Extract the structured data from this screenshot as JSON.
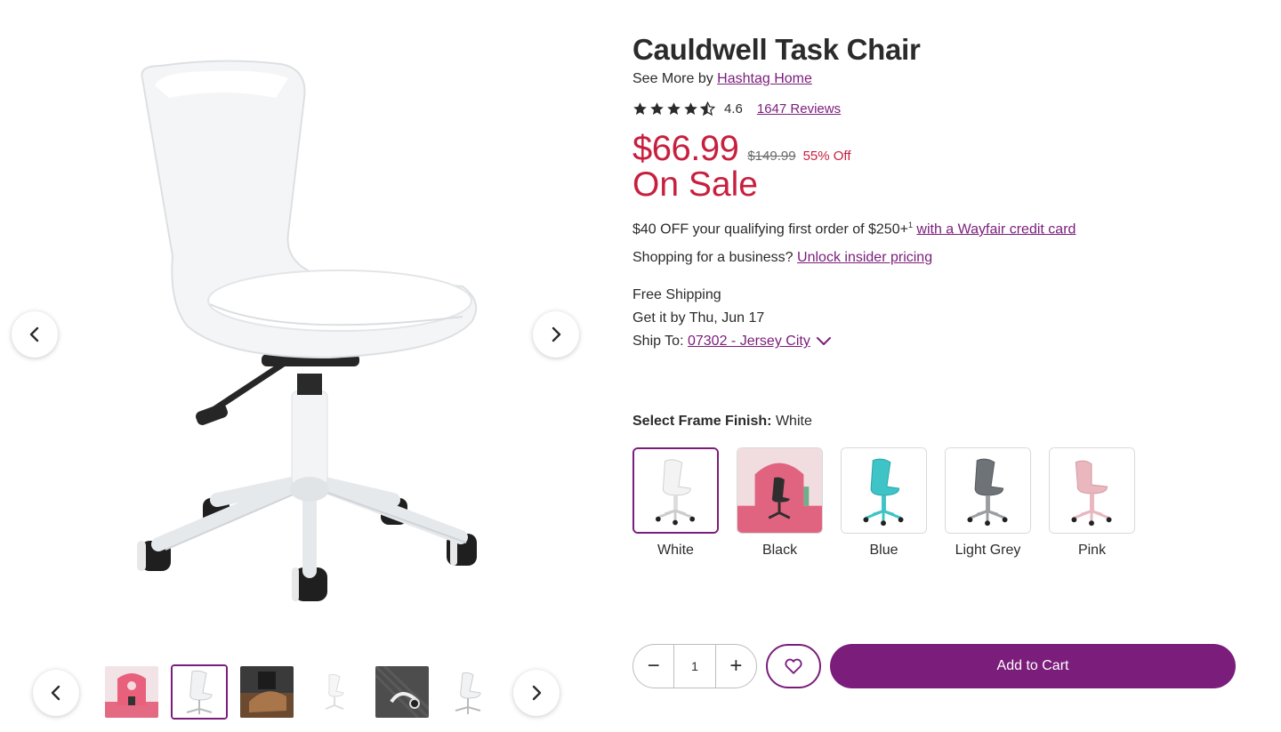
{
  "product": {
    "title": "Cauldwell Task Chair",
    "see_more_prefix": "See More by",
    "brand": "Hashtag Home",
    "rating": "4.6",
    "stars": 4.5,
    "reviews_link": "1647 Reviews",
    "price": "$66.99",
    "original_price": "$149.99",
    "discount": "55% Off",
    "sale_label": "On Sale"
  },
  "promo": {
    "text": "$40 OFF your qualifying first order of $250+",
    "superscript": "1",
    "link": "with a Wayfair credit card"
  },
  "business": {
    "text": "Shopping for a business?",
    "link": "Unlock insider pricing"
  },
  "shipping": {
    "free": "Free Shipping",
    "delivery": "Get it by Thu, Jun 17",
    "ship_to_label": "Ship To:",
    "ship_to_link": "07302 - Jersey City"
  },
  "finish": {
    "label": "Select Frame Finish:",
    "selected": "White",
    "options": [
      "White",
      "Black",
      "Blue",
      "Light Grey",
      "Pink"
    ]
  },
  "cart": {
    "minus": "−",
    "quantity": "1",
    "plus": "+",
    "add_to_cart": "Add to Cart"
  },
  "colors": {
    "brand_purple": "#7b1d7b",
    "sale_red": "#c7203f"
  },
  "icons": {
    "prev": "chevron-left-icon",
    "next": "chevron-right-icon",
    "favorite": "heart-icon",
    "star": "star-icon",
    "dropdown": "chevron-down-icon"
  }
}
